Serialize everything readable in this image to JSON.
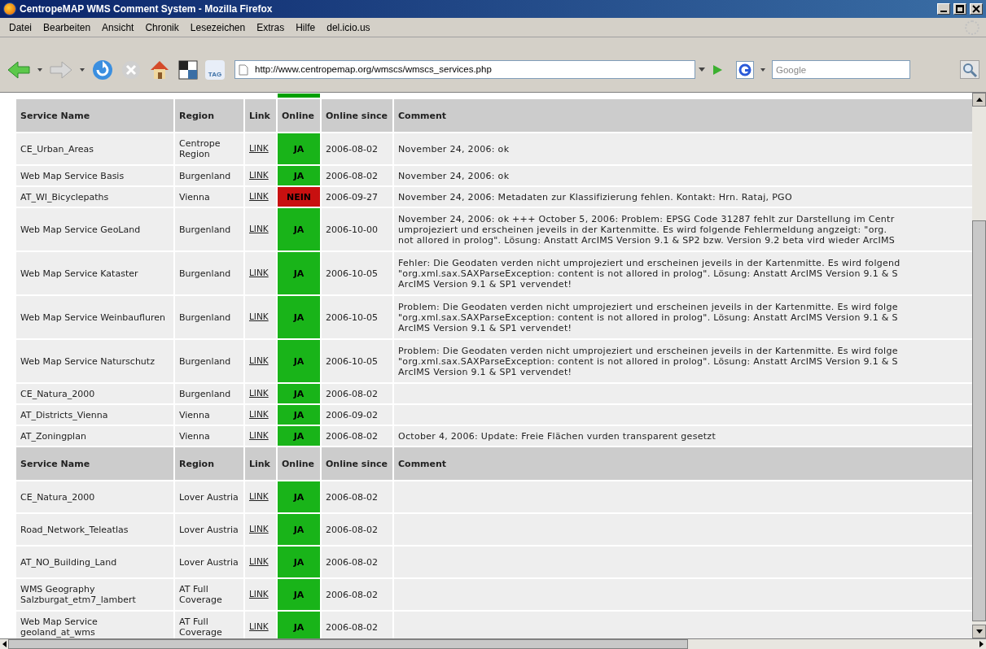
{
  "window": {
    "title": "CentropeMAP WMS Comment System - Mozilla Firefox"
  },
  "menu": [
    "Datei",
    "Bearbeiten",
    "Ansicht",
    "Chronik",
    "Lesezeichen",
    "Extras",
    "Hilfe",
    "del.icio.us"
  ],
  "toolbar": {
    "url": "http://www.centropemap.org/wmscs/wmscs_services.php",
    "search_placeholder": "Google",
    "tag_label": "TAG"
  },
  "cut_row": {
    "online": true
  },
  "sections": [
    {
      "columns": [
        "Service Name",
        "Region",
        "Link",
        "Online",
        "Online since",
        "Comment"
      ],
      "rows": [
        {
          "service_name": "CE_Urban_Areas",
          "region": "Centrope Region",
          "link": "LINK",
          "online": true,
          "status": "JA",
          "online_since": "2006-08-02",
          "comment": [
            "November 24, 2006: ok"
          ]
        },
        {
          "service_name": "Web Map Service Basis",
          "region": "Burgenland",
          "link": "LINK",
          "online": true,
          "status": "JA",
          "online_since": "2006-08-02",
          "comment": [
            "November 24, 2006: ok"
          ]
        },
        {
          "service_name": "AT_WI_Bicyclepaths",
          "region": "Vienna",
          "link": "LINK",
          "online": false,
          "status": "NEIN",
          "online_since": "2006-09-27",
          "comment": [
            "November 24, 2006: Metadaten zur Klassifizierung fehlen. Kontakt: Hrn. Rataj, PGO"
          ]
        },
        {
          "service_name": "Web Map Service GeoLand",
          "region": "Burgenland",
          "link": "LINK",
          "online": true,
          "status": "JA",
          "online_since": "2006-10-00",
          "comment": [
            "November 24, 2006: ok +++ October 5, 2006: Problem: EPSG Code 31287 fehlt zur Darstellung im Centr",
            "umprojeziert und erscheinen jeveils in der Kartenmitte. Es wird folgende Fehlermeldung angzeigt: \"org.",
            "not allored in prolog\". Lösung: Anstatt ArcIMS Version 9.1 & SP2 bzw. Version 9.2 beta vird wieder ArcIMS"
          ]
        },
        {
          "service_name": "Web Map Service Kataster",
          "region": "Burgenland",
          "link": "LINK",
          "online": true,
          "status": "JA",
          "online_since": "2006-10-05",
          "comment": [
            "Fehler: Die Geodaten verden nicht umprojeziert und erscheinen jeveils in der Kartenmitte. Es wird folgend",
            "\"org.xml.sax.SAXParseException: content is not allored in prolog\". Lösung: Anstatt ArcIMS Version 9.1 & S",
            "ArcIMS Version 9.1 & SP1 vervendet!"
          ]
        },
        {
          "service_name": "Web Map Service Weinbaufluren",
          "region": "Burgenland",
          "link": "LINK",
          "online": true,
          "status": "JA",
          "online_since": "2006-10-05",
          "comment": [
            "Problem: Die Geodaten verden nicht umprojeziert und erscheinen jeveils in der Kartenmitte. Es wird folge",
            "\"org.xml.sax.SAXParseException: content is not allored in prolog\". Lösung: Anstatt ArcIMS Version 9.1 & S",
            "ArcIMS Version 9.1 & SP1 vervendet!"
          ]
        },
        {
          "service_name": "Web Map Service Naturschutz",
          "region": "Burgenland",
          "link": "LINK",
          "online": true,
          "status": "JA",
          "online_since": "2006-10-05",
          "comment": [
            "Problem: Die Geodaten verden nicht umprojeziert und erscheinen jeveils in der Kartenmitte. Es wird folge",
            "\"org.xml.sax.SAXParseException: content is not allored in prolog\". Lösung: Anstatt ArcIMS Version 9.1 & S",
            "ArcIMS Version 9.1 & SP1 vervendet!"
          ]
        },
        {
          "service_name": "CE_Natura_2000",
          "region": "Burgenland",
          "link": "LINK",
          "online": true,
          "status": "JA",
          "online_since": "2006-08-02"
        },
        {
          "service_name": "AT_Districts_Vienna",
          "region": "Vienna",
          "link": "LINK",
          "online": true,
          "status": "JA",
          "online_since": "2006-09-02"
        },
        {
          "service_name": "AT_Zoningplan",
          "region": "Vienna",
          "link": "LINK",
          "online": true,
          "status": "JA",
          "online_since": "2006-08-02",
          "comment": [
            "October 4, 2006: Update: Freie Flächen vurden transparent gesetzt"
          ]
        }
      ]
    },
    {
      "columns": [
        "Service Name",
        "Region",
        "Link",
        "Online",
        "Online since",
        "Comment"
      ],
      "rows": [
        {
          "service_name": "CE_Natura_2000",
          "region": "Lover Austria",
          "link": "LINK",
          "online": true,
          "status": "JA",
          "online_since": "2006-08-02"
        },
        {
          "service_name": "Road_Network_Teleatlas",
          "region": "Lover Austria",
          "link": "LINK",
          "online": true,
          "status": "JA",
          "online_since": "2006-08-02"
        },
        {
          "service_name": "AT_NO_Building_Land",
          "region": "Lover Austria",
          "link": "LINK",
          "online": true,
          "status": "JA",
          "online_since": "2006-08-02"
        },
        {
          "service_name": "WMS Geography Salzburgat_etm7_lambert",
          "region": "AT Full Coverage",
          "link": "LINK",
          "online": true,
          "status": "JA",
          "online_since": "2006-08-02"
        },
        {
          "service_name": "Web Map Service geoland_at_wms",
          "region": "AT Full Coverage",
          "link": "LINK",
          "online": true,
          "status": "JA",
          "online_since": "2006-08-02"
        }
      ]
    }
  ]
}
